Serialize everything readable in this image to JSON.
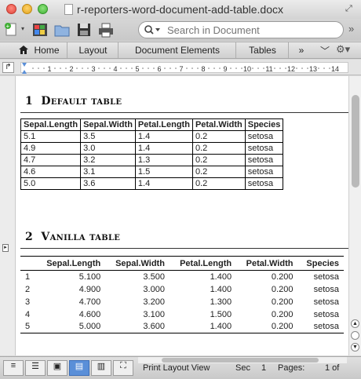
{
  "window": {
    "title": "r-reporters-word-document-add-table.docx"
  },
  "toolbar": {
    "search_placeholder": "Search in Document"
  },
  "ribbon": {
    "tabs": [
      {
        "label": "Home",
        "icon": "home-icon"
      },
      {
        "label": "Layout"
      },
      {
        "label": "Document Elements"
      },
      {
        "label": "Tables"
      },
      {
        "label": "»"
      }
    ]
  },
  "document": {
    "section1": {
      "number": "1",
      "title": "Default table"
    },
    "section2": {
      "number": "2",
      "title": "Vanilla table"
    },
    "table1": {
      "headers": [
        "Sepal.Length",
        "Sepal.Width",
        "Petal.Length",
        "Petal.Width",
        "Species"
      ],
      "rows": [
        [
          "5.1",
          "3.5",
          "1.4",
          "0.2",
          "setosa"
        ],
        [
          "4.9",
          "3.0",
          "1.4",
          "0.2",
          "setosa"
        ],
        [
          "4.7",
          "3.2",
          "1.3",
          "0.2",
          "setosa"
        ],
        [
          "4.6",
          "3.1",
          "1.5",
          "0.2",
          "setosa"
        ],
        [
          "5.0",
          "3.6",
          "1.4",
          "0.2",
          "setosa"
        ]
      ]
    },
    "table2": {
      "headers": [
        "",
        "Sepal.Length",
        "Sepal.Width",
        "Petal.Length",
        "Petal.Width",
        "Species"
      ],
      "rows": [
        [
          "1",
          "5.100",
          "3.500",
          "1.400",
          "0.200",
          "setosa"
        ],
        [
          "2",
          "4.900",
          "3.000",
          "1.400",
          "0.200",
          "setosa"
        ],
        [
          "3",
          "4.700",
          "3.200",
          "1.300",
          "0.200",
          "setosa"
        ],
        [
          "4",
          "4.600",
          "3.100",
          "1.500",
          "0.200",
          "setosa"
        ],
        [
          "5",
          "5.000",
          "3.600",
          "1.400",
          "0.200",
          "setosa"
        ]
      ]
    }
  },
  "statusbar": {
    "view": "Print Layout View",
    "sec_label": "Sec",
    "sec_value": "1",
    "pages_label": "Pages:",
    "pages_value": "1 of"
  },
  "ruler": {
    "ticks": [
      "1",
      "2",
      "3",
      "4",
      "5",
      "6",
      "7",
      "8",
      "9",
      "10",
      "11",
      "12",
      "13",
      "14"
    ]
  }
}
